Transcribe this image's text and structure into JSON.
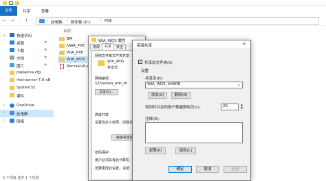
{
  "explorer": {
    "ribbon_tabs": [
      "文件",
      "共享",
      "查看"
    ],
    "breadcrumb": [
      "此电脑",
      "新加卷 (D:)",
      "PXE"
    ],
    "column_name": "名称",
    "nav_items": [
      {
        "label": "快速访问",
        "pinned": false
      },
      {
        "label": "桌面",
        "pinned": true
      },
      {
        "label": "下载",
        "pinned": true
      },
      {
        "label": "文档",
        "pinned": true
      },
      {
        "label": "图片",
        "pinned": true
      },
      {
        "label": "pxeserva.cfg",
        "pinned": false
      },
      {
        "label": "rhel-server-7.6-x8",
        "pinned": false
      },
      {
        "label": "System32",
        "pinned": false
      },
      {
        "label": "课件",
        "pinned": false
      },
      {
        "label": "OneDrive",
        "pinned": false
      },
      {
        "label": "此电脑",
        "pinned": false
      },
      {
        "label": "网络",
        "pinned": false
      }
    ],
    "files": [
      {
        "name": "BM",
        "type": "folder"
      },
      {
        "name": "NWA_PXE",
        "type": "folder"
      },
      {
        "name": "WIA_PXE",
        "type": "folder"
      },
      {
        "name": "WIA_WDS",
        "type": "folder"
      },
      {
        "name": "Serva$UA.pdf",
        "type": "pdf"
      }
    ],
    "status": "5 个项目    选中 1 个项目"
  },
  "properties": {
    "title": "WIA_WDS 属性",
    "tabs": [
      "常规",
      "共享",
      "安全"
    ],
    "sharing_heading": "网络文件和文件夹共享",
    "share_name": "WIA_WDS",
    "share_state": "共享式",
    "network_path_label": "网络路径:",
    "network_path": "\\\\Zhuo\\wia_wds_sh",
    "share_button": "共享(S)...",
    "advanced_heading": "高级共享",
    "advanced_desc": "设置自定义权限，创建多",
    "advanced_button": "高级共享(D)...",
    "password_heading": "密码保护",
    "password_desc1": "用户必须具有此计算机",
    "password_desc2": "若要更改此设置，请使"
  },
  "advanced_sharing": {
    "title": "高级共享",
    "close_glyph": "×",
    "share_checkbox_label": "共享此文件夹(S)",
    "share_checked": true,
    "settings_label": "设置",
    "share_name_label": "共享名(H):",
    "share_name_value": "WIA_WDS_SHARE",
    "add_button": "添加(A)",
    "remove_button": "删除(R)",
    "limit_label": "将同时共享的用户数量限制为(L):",
    "limit_value": "20",
    "comment_label": "注释(O):",
    "permissions_button": "权限(P)",
    "caching_button": "缓存(C)",
    "ok_button": "确定",
    "cancel_button": "取消",
    "apply_button": "应用"
  }
}
